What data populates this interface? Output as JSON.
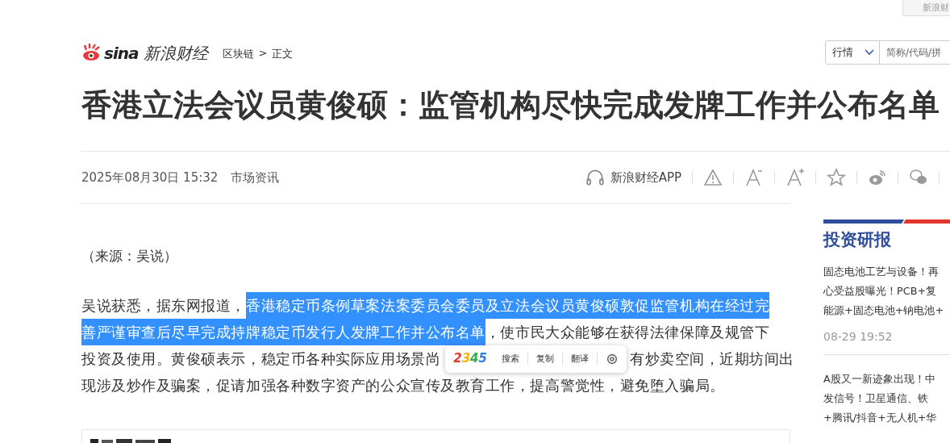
{
  "top_bar": {
    "button": "新浪财"
  },
  "header": {
    "logo_mark": "sina",
    "logo_text": "新浪财经",
    "breadcrumb": [
      "区块链",
      ">",
      "正文"
    ],
    "search": {
      "select": "行情",
      "placeholder": "简称/代码/拼"
    }
  },
  "article": {
    "title": "香港立法会议员黄俊硕：监管机构尽快完成发牌工作并公布名单",
    "date": "2025年08月30日 15:32",
    "source": "市场资讯",
    "app_link": "新浪财经APP",
    "source_note": "（来源：吴说）",
    "body_lines": [
      {
        "segments": [
          {
            "text": "吴说获悉，据东网报道，",
            "selected": false
          },
          {
            "text": "香港稳定币条例草案法案委员会委员及立法会议员黄俊硕敦促监管机构在经过完",
            "selected": true
          }
        ]
      },
      {
        "segments": [
          {
            "text": "善严谨审查后尽早完成持牌稳定币发行人发牌工作并公布名单",
            "selected": true
          },
          {
            "text": "，使市民大众能够在获得法律保障及规管下",
            "selected": false
          }
        ]
      },
      {
        "segments": [
          {
            "text": "投资及使用。黄俊硕表示，稳定币各种实际应用场景尚",
            "selected": false
          },
          {
            "kind": "popup"
          },
          {
            "text": "有炒卖空间，近期坊间出",
            "selected": false
          }
        ]
      },
      {
        "segments": [
          {
            "text": "现涉及炒作及骗案，促请加强各种数字资产的公众宣传及教育工作，提高警觉性，避免堕入骗局。",
            "selected": false
          }
        ]
      }
    ]
  },
  "selection_popup": {
    "logo": "2345",
    "actions": [
      "搜索",
      "复制",
      "翻译"
    ]
  },
  "sidebar": {
    "title": "投资研报",
    "items": [
      {
        "lines": [
          "固态电池工艺与设备！再",
          "心受益股曝光！PCB+复",
          "能源+固态电池+钠电池+"
        ],
        "time": "08-29 19:52"
      },
      {
        "lines": [
          "A股又一新迹象出现！中",
          "发信号！卫星通信、铁",
          "+腾讯/抖音+无人机+华"
        ]
      }
    ]
  }
}
